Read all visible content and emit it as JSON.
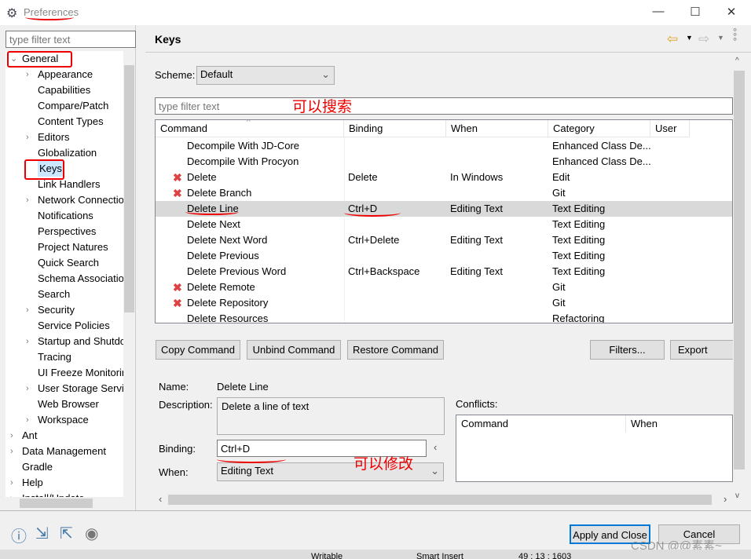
{
  "window": {
    "title": "Preferences",
    "minimize": "—",
    "maximize": "☐",
    "close": "✕"
  },
  "left": {
    "filter_placeholder": "type filter text",
    "tree": [
      {
        "label": "General",
        "level": 0,
        "expanded": true
      },
      {
        "label": "Appearance",
        "level": 1,
        "chev": true
      },
      {
        "label": "Capabilities",
        "level": 1
      },
      {
        "label": "Compare/Patch",
        "level": 1
      },
      {
        "label": "Content Types",
        "level": 1
      },
      {
        "label": "Editors",
        "level": 1,
        "chev": true
      },
      {
        "label": "Globalization",
        "level": 1
      },
      {
        "label": "Keys",
        "level": 1,
        "selected": true
      },
      {
        "label": "Link Handlers",
        "level": 1
      },
      {
        "label": "Network Connectio",
        "level": 1,
        "chev": true
      },
      {
        "label": "Notifications",
        "level": 1
      },
      {
        "label": "Perspectives",
        "level": 1
      },
      {
        "label": "Project Natures",
        "level": 1
      },
      {
        "label": "Quick Search",
        "level": 1
      },
      {
        "label": "Schema Associatior",
        "level": 1
      },
      {
        "label": "Search",
        "level": 1
      },
      {
        "label": "Security",
        "level": 1,
        "chev": true
      },
      {
        "label": "Service Policies",
        "level": 1
      },
      {
        "label": "Startup and Shutdo",
        "level": 1,
        "chev": true
      },
      {
        "label": "Tracing",
        "level": 1
      },
      {
        "label": "UI Freeze Monitorir",
        "level": 1
      },
      {
        "label": "User Storage Servic",
        "level": 1,
        "chev": true
      },
      {
        "label": "Web Browser",
        "level": 1
      },
      {
        "label": "Workspace",
        "level": 1,
        "chev": true
      },
      {
        "label": "Ant",
        "level": 0,
        "chev": true
      },
      {
        "label": "Data Management",
        "level": 0,
        "chev": true
      },
      {
        "label": "Gradle",
        "level": 0
      },
      {
        "label": "Help",
        "level": 0,
        "chev": true
      },
      {
        "label": "Install/Update",
        "level": 0,
        "chev": true
      }
    ]
  },
  "page": {
    "title": "Keys",
    "scheme_label": "Scheme:",
    "scheme_value": "Default",
    "filter_placeholder": "type filter text",
    "columns": [
      "Command",
      "Binding",
      "When",
      "Category",
      "User"
    ],
    "rows": [
      {
        "command": "Decompile With JD-Core",
        "binding": "",
        "when": "",
        "category": "Enhanced Class De...",
        "icon": false
      },
      {
        "command": "Decompile With Procyon",
        "binding": "",
        "when": "",
        "category": "Enhanced Class De...",
        "icon": false
      },
      {
        "command": "Delete",
        "binding": "Delete",
        "when": "In Windows",
        "category": "Edit",
        "icon": true
      },
      {
        "command": "Delete Branch",
        "binding": "",
        "when": "",
        "category": "Git",
        "icon": true
      },
      {
        "command": "Delete Line",
        "binding": "Ctrl+D",
        "when": "Editing Text",
        "category": "Text Editing",
        "icon": false,
        "selected": true
      },
      {
        "command": "Delete Next",
        "binding": "",
        "when": "",
        "category": "Text Editing",
        "icon": false
      },
      {
        "command": "Delete Next Word",
        "binding": "Ctrl+Delete",
        "when": "Editing Text",
        "category": "Text Editing",
        "icon": false
      },
      {
        "command": "Delete Previous",
        "binding": "",
        "when": "",
        "category": "Text Editing",
        "icon": false
      },
      {
        "command": "Delete Previous Word",
        "binding": "Ctrl+Backspace",
        "when": "Editing Text",
        "category": "Text Editing",
        "icon": false
      },
      {
        "command": "Delete Remote",
        "binding": "",
        "when": "",
        "category": "Git",
        "icon": true
      },
      {
        "command": "Delete Repository",
        "binding": "",
        "when": "",
        "category": "Git",
        "icon": true
      },
      {
        "command": "Delete Resources",
        "binding": "",
        "when": "",
        "category": "Refactoring",
        "icon": false
      }
    ],
    "buttons": {
      "copy": "Copy Command",
      "unbind": "Unbind Command",
      "restore": "Restore Command",
      "filters": "Filters...",
      "export": "Export CSV..."
    },
    "details": {
      "name_label": "Name:",
      "name_value": "Delete Line",
      "description_label": "Description:",
      "description_value": "Delete a line of text",
      "binding_label": "Binding:",
      "binding_value": "Ctrl+D",
      "when_label": "When:",
      "when_value": "Editing Text",
      "conflicts_label": "Conflicts:",
      "conflicts_columns": [
        "Command",
        "When"
      ]
    }
  },
  "footer": {
    "apply_close": "Apply and Close",
    "cancel": "Cancel",
    "watermark": "CSDN @@素素~",
    "status": [
      "Writable",
      "Smart Insert",
      "49 : 13 : 1603"
    ]
  },
  "annotations": {
    "search": "可以搜索",
    "modify": "可以修改",
    "color": "#e00000"
  }
}
